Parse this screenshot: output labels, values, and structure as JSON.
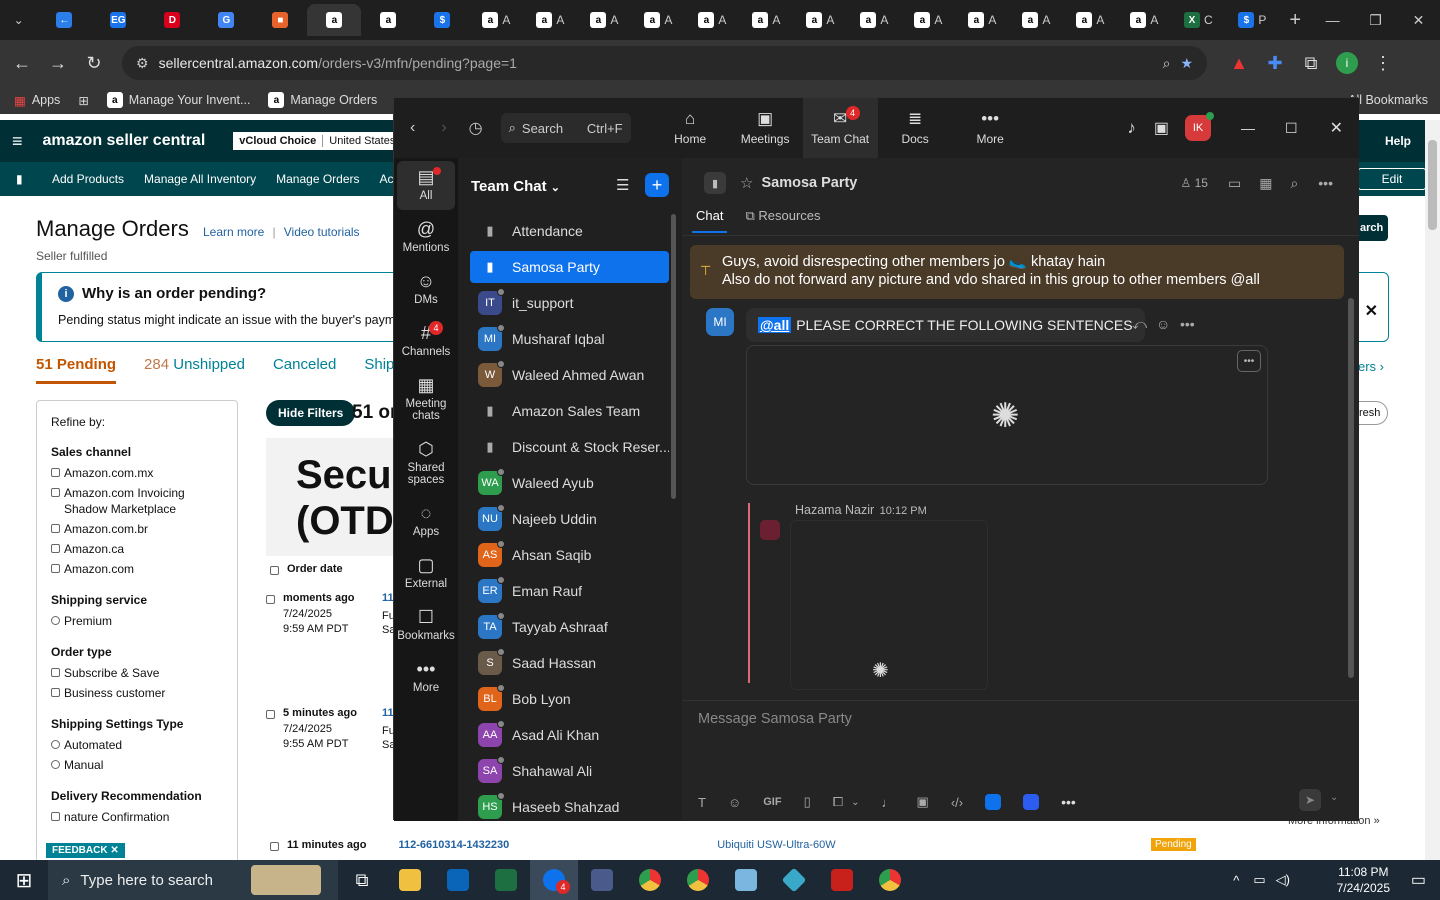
{
  "browser": {
    "tabs": [
      {
        "letter": "←",
        "color": "#2b7de9"
      },
      {
        "letter": "EG",
        "color": "#1a73e8"
      },
      {
        "letter": "D",
        "color": "#d9001b"
      },
      {
        "letter": "G",
        "color": "#4285f4"
      },
      {
        "letter": "■",
        "color": "#e8622c"
      },
      {
        "letter": "a",
        "color": "#000",
        "active": true
      },
      {
        "letter": "a",
        "color": "#000"
      },
      {
        "letter": "$",
        "color": "#1a73e8"
      },
      {
        "letter": "a",
        "color": "#000",
        "label": "A"
      },
      {
        "letter": "a",
        "color": "#000",
        "label": "A"
      },
      {
        "letter": "a",
        "color": "#000",
        "label": "A"
      },
      {
        "letter": "a",
        "color": "#000",
        "label": "A"
      },
      {
        "letter": "a",
        "color": "#000",
        "label": "A"
      },
      {
        "letter": "a",
        "color": "#000",
        "label": "A"
      },
      {
        "letter": "a",
        "color": "#000",
        "label": "A"
      },
      {
        "letter": "a",
        "color": "#000",
        "label": "A"
      },
      {
        "letter": "a",
        "color": "#555",
        "label": "A"
      },
      {
        "letter": "a",
        "color": "#000",
        "label": "A"
      },
      {
        "letter": "a",
        "color": "#555",
        "label": "A"
      },
      {
        "letter": "a",
        "color": "#555",
        "label": "A"
      },
      {
        "letter": "a",
        "color": "#555",
        "label": "A"
      },
      {
        "letter": "X",
        "color": "#1d6f42",
        "label": "C"
      },
      {
        "letter": "$",
        "color": "#1a73e8",
        "label": "P"
      }
    ],
    "url_host": "sellercentral.amazon.com",
    "url_path": "/orders-v3/mfn/pending?page=1",
    "bookmarks": [
      {
        "label": "Apps"
      },
      {
        "label": "Manage Your Invent..."
      },
      {
        "label": "Manage Orders"
      }
    ],
    "all_bookmarks": "All Bookmarks"
  },
  "amazon": {
    "logo": "amazon seller central",
    "vcloud": "vCloud Choice",
    "marketplace": "United States",
    "help": "Help",
    "nav": [
      "Add Products",
      "Manage All Inventory",
      "Manage Orders",
      "Account Heal"
    ],
    "edit": "Edit",
    "title": "Manage Orders",
    "learn_more": "Learn more",
    "video_tutorials": "Video tutorials",
    "subtitle": "Seller fulfilled",
    "info_title": "Why is an order pending?",
    "info_text": "Pending status might indicate an issue with the buyer's payment m",
    "tabs": [
      {
        "count": "51",
        "label": "Pending"
      },
      {
        "count": "284",
        "label": "Unshipped"
      },
      {
        "count": "",
        "label": "Canceled"
      },
      {
        "count": "",
        "label": "Shippe"
      }
    ],
    "search_btn": "arch",
    "refresh_btn": "resh",
    "tab_more": "ers",
    "refine_by": "Refine by:",
    "filter_groups": [
      {
        "title": "Sales channel",
        "kind": "checkbox",
        "options": [
          "Amazon.com.mx",
          "Amazon.com Invoicing Shadow Marketplace",
          "Amazon.com.br",
          "Amazon.ca",
          "Amazon.com"
        ]
      },
      {
        "title": "Shipping service",
        "kind": "radio",
        "options": [
          "Premium"
        ]
      },
      {
        "title": "Order type",
        "kind": "checkbox",
        "options": [
          "Subscribe & Save",
          "Business customer"
        ]
      },
      {
        "title": "Shipping Settings Type",
        "kind": "radio",
        "options": [
          "Automated",
          "Manual"
        ]
      },
      {
        "title": "Delivery Recommendation",
        "kind": "checkbox",
        "options": [
          "nature Confirmation"
        ]
      }
    ],
    "hide_filters": "Hide Filters",
    "order_count": "51 or",
    "banner_text": "Secu (OTD",
    "col_order_date": "Order date",
    "col_or": "Or",
    "orders": [
      {
        "age": "moments ago",
        "date": "7/24/2025",
        "time": "9:59 AM PDT",
        "link": "11",
        "sub1": "Fu",
        "sub2": "Sa"
      },
      {
        "age": "5 minutes ago",
        "date": "7/24/2025",
        "time": "9:55 AM PDT",
        "link": "11",
        "sub1": "Fu",
        "sub2": "Sa"
      }
    ],
    "last_order": {
      "age": "11 minutes ago",
      "id": "112-6610314-1432230",
      "product": "Ubiquiti USW-Ultra-60W",
      "status": "Pending"
    },
    "more_info": "More information »",
    "feedback": "FEEDBACK ✕"
  },
  "zoom": {
    "search_label": "Search",
    "search_shortcut": "Ctrl+F",
    "top": [
      {
        "name": "home",
        "label": "Home",
        "icon": "⌂"
      },
      {
        "name": "meetings",
        "label": "Meetings",
        "icon": "▣"
      },
      {
        "name": "team-chat",
        "label": "Team Chat",
        "icon": "✉",
        "badge": "4",
        "active": true
      },
      {
        "name": "docs",
        "label": "Docs",
        "icon": "≣"
      },
      {
        "name": "more",
        "label": "More",
        "icon": "•••"
      }
    ],
    "profile_initials": "IK",
    "side": [
      {
        "name": "all",
        "label": "All",
        "icon": "▤",
        "active": true
      },
      {
        "name": "mentions",
        "label": "Mentions",
        "icon": "@"
      },
      {
        "name": "dms",
        "label": "DMs",
        "icon": "☺"
      },
      {
        "name": "channels",
        "label": "Channels",
        "icon": "#",
        "badge": "4"
      },
      {
        "name": "meeting-chats",
        "label": "Meeting chats",
        "icon": "▦"
      },
      {
        "name": "shared-spaces",
        "label": "Shared spaces",
        "icon": "⬡"
      },
      {
        "name": "apps",
        "label": "Apps",
        "icon": "◌"
      },
      {
        "name": "external",
        "label": "External",
        "icon": "▢"
      },
      {
        "name": "bookmarks",
        "label": "Bookmarks",
        "icon": "☐"
      },
      {
        "name": "more",
        "label": "More",
        "icon": "•••"
      }
    ],
    "list_title": "Team Chat",
    "chats": [
      {
        "name": "Attendance",
        "lock": true
      },
      {
        "name": "Samosa Party",
        "lock": true,
        "active": true
      },
      {
        "name": "it_support",
        "initials": "IT",
        "color": "#3a4a8a"
      },
      {
        "name": "Musharaf Iqbal",
        "initials": "MI",
        "color": "#2b77c5"
      },
      {
        "name": "Waleed Ahmed Awan",
        "initials": "W",
        "color": "#7a5a3a"
      },
      {
        "name": "Amazon Sales Team",
        "lock": true
      },
      {
        "name": "Discount & Stock Reser...",
        "lock": true
      },
      {
        "name": "Waleed Ayub",
        "initials": "WA",
        "color": "#2e9e4e"
      },
      {
        "name": "Najeeb Uddin",
        "initials": "NU",
        "color": "#2b77c5"
      },
      {
        "name": "Ahsan Saqib",
        "initials": "AS",
        "color": "#e0641a"
      },
      {
        "name": "Eman Rauf",
        "initials": "ER",
        "color": "#2b77c5"
      },
      {
        "name": "Tayyab Ashraaf",
        "initials": "TA",
        "color": "#2b77c5"
      },
      {
        "name": "Saad Hassan",
        "initials": "S",
        "color": "#6a5a4a"
      },
      {
        "name": "Bob Lyon",
        "initials": "BL",
        "color": "#e0641a"
      },
      {
        "name": "Asad Ali Khan",
        "initials": "AA",
        "color": "#8e44ad"
      },
      {
        "name": "Shahawal Ali",
        "initials": "SA",
        "color": "#8e44ad"
      },
      {
        "name": "Haseeb Shahzad",
        "initials": "HS",
        "color": "#2e9e4e"
      }
    ],
    "channel_name": "Samosa Party",
    "member_count": "15",
    "tab_chat": "Chat",
    "tab_resources": "Resources",
    "pinned_line1": "Guys, avoid disrespecting other members jo 🥿 khatay hain",
    "pinned_line2": "Also do not forward any picture and vdo shared in this group to other members @all",
    "msg_avatar": "MI",
    "msg_mention": "@all",
    "msg_text": "PLEASE CORRECT THE FOLLOWING SENTENCES",
    "reply_author": "Hazama Nazir",
    "reply_time": "10:12 PM",
    "composer_placeholder": "Message Samosa Party"
  },
  "taskbar": {
    "search_placeholder": "Type here to search",
    "time": "11:08 PM",
    "date": "7/24/2025",
    "zoom_badge": "4"
  }
}
